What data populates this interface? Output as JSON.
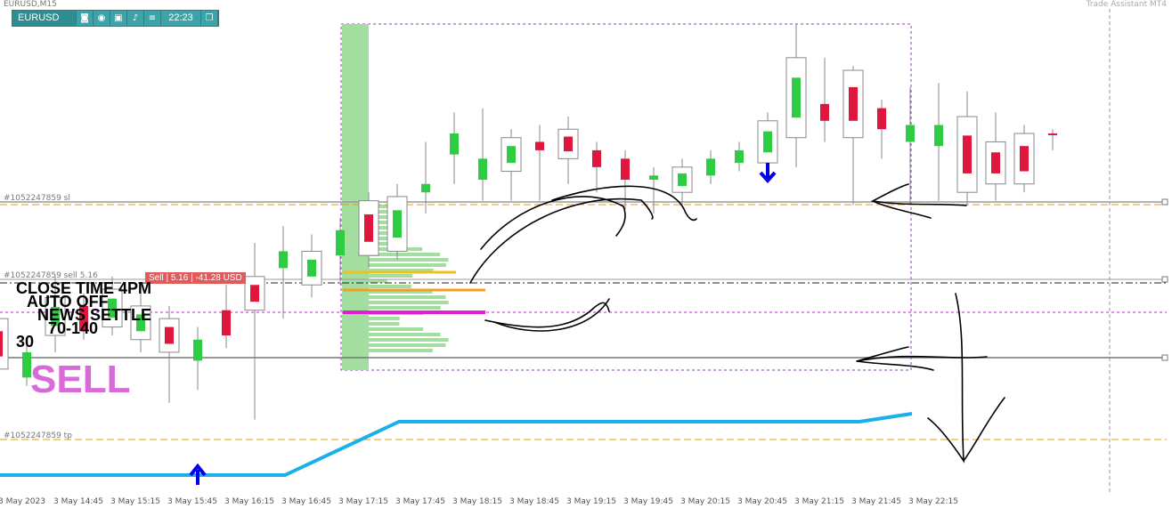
{
  "window": {
    "title": "EURUSD,M15",
    "assistant": "Trade Assistant MT4"
  },
  "toolbar": {
    "symbol": "EURUSD",
    "time": "22:23",
    "icons": [
      "camera-icon",
      "eye-icon",
      "calendar-icon",
      "bell-icon",
      "menu-icon"
    ]
  },
  "order_labels": {
    "sl": "#1052247859 sl",
    "sell": "#1052247859 sell 5.16",
    "tp": "#1052247859 tp",
    "badge": "Sell | 5.16 | -41.28 USD"
  },
  "notes": {
    "line1": "CLOSE TIME 4PM",
    "line2": "AUTO OFF",
    "line3": "NEWS SETTLE",
    "line4": "70-140",
    "line5": "30",
    "sell": "SELL"
  },
  "time_axis": [
    "3 May 2023",
    "3 May 14:45",
    "3 May 15:15",
    "3 May 15:45",
    "3 May 16:15",
    "3 May 16:45",
    "3 May 17:15",
    "3 May 17:45",
    "3 May 18:15",
    "3 May 18:45",
    "3 May 19:15",
    "3 May 19:45",
    "3 May 20:15",
    "3 May 20:45",
    "3 May 21:15",
    "3 May 21:45",
    "3 May 22:15"
  ],
  "colors": {
    "bull": "#2ecc40",
    "bear": "#e0163c",
    "blue_line": "#1ab0ea",
    "arrow": "#0000ff"
  },
  "candles": [
    {
      "o": 0.3,
      "c": 0.18,
      "h": 0.32,
      "l": 0.12
    },
    {
      "o": 0.16,
      "c": 0.22,
      "h": 0.24,
      "l": 0.14
    },
    {
      "o": 0.26,
      "c": 0.35,
      "h": 0.4,
      "l": 0.22
    },
    {
      "o": 0.33,
      "c": 0.27,
      "h": 0.36,
      "l": 0.25
    },
    {
      "o": 0.28,
      "c": 0.37,
      "h": 0.4,
      "l": 0.26
    },
    {
      "o": 0.25,
      "c": 0.33,
      "h": 0.36,
      "l": 0.22
    },
    {
      "o": 0.3,
      "c": 0.22,
      "h": 0.33,
      "l": 0.1
    },
    {
      "o": 0.2,
      "c": 0.25,
      "h": 0.28,
      "l": 0.13
    },
    {
      "o": 0.32,
      "c": 0.26,
      "h": 0.38,
      "l": 0.23
    },
    {
      "o": 0.4,
      "c": 0.32,
      "h": 0.48,
      "l": 0.06
    },
    {
      "o": 0.42,
      "c": 0.46,
      "h": 0.52,
      "l": 0.3
    },
    {
      "o": 0.38,
      "c": 0.46,
      "h": 0.5,
      "l": 0.35
    },
    {
      "o": 0.45,
      "c": 0.51,
      "h": 0.54,
      "l": 0.38
    },
    {
      "o": 0.58,
      "c": 0.45,
      "h": 0.6,
      "l": 0.42
    },
    {
      "o": 0.46,
      "c": 0.59,
      "h": 0.62,
      "l": 0.44
    },
    {
      "o": 0.6,
      "c": 0.62,
      "h": 0.72,
      "l": 0.55
    },
    {
      "o": 0.69,
      "c": 0.74,
      "h": 0.79,
      "l": 0.62
    },
    {
      "o": 0.63,
      "c": 0.68,
      "h": 0.8,
      "l": 0.58
    },
    {
      "o": 0.65,
      "c": 0.73,
      "h": 0.75,
      "l": 0.58
    },
    {
      "o": 0.72,
      "c": 0.7,
      "h": 0.76,
      "l": 0.58
    },
    {
      "o": 0.75,
      "c": 0.68,
      "h": 0.78,
      "l": 0.62
    },
    {
      "o": 0.7,
      "c": 0.66,
      "h": 0.72,
      "l": 0.6
    },
    {
      "o": 0.68,
      "c": 0.63,
      "h": 0.7,
      "l": 0.56
    },
    {
      "o": 0.63,
      "c": 0.64,
      "h": 0.66,
      "l": 0.55
    },
    {
      "o": 0.6,
      "c": 0.66,
      "h": 0.68,
      "l": 0.57
    },
    {
      "o": 0.64,
      "c": 0.68,
      "h": 0.7,
      "l": 0.62
    },
    {
      "o": 0.67,
      "c": 0.7,
      "h": 0.72,
      "l": 0.65
    },
    {
      "o": 0.67,
      "c": 0.77,
      "h": 0.79,
      "l": 0.65
    },
    {
      "o": 0.73,
      "c": 0.92,
      "h": 1.0,
      "l": 0.66
    },
    {
      "o": 0.81,
      "c": 0.77,
      "h": 0.92,
      "l": 0.72
    },
    {
      "o": 0.89,
      "c": 0.73,
      "h": 0.9,
      "l": 0.57
    },
    {
      "o": 0.8,
      "c": 0.75,
      "h": 0.82,
      "l": 0.68
    },
    {
      "o": 0.72,
      "c": 0.76,
      "h": 0.85,
      "l": 0.57
    },
    {
      "o": 0.71,
      "c": 0.76,
      "h": 0.86,
      "l": 0.58
    },
    {
      "o": 0.78,
      "c": 0.6,
      "h": 0.84,
      "l": 0.57
    },
    {
      "o": 0.72,
      "c": 0.62,
      "h": 0.79,
      "l": 0.58
    },
    {
      "o": 0.74,
      "c": 0.62,
      "h": 0.76,
      "l": 0.6
    },
    {
      "o": 0.74,
      "c": 0.74,
      "h": 0.75,
      "l": 0.7
    }
  ]
}
